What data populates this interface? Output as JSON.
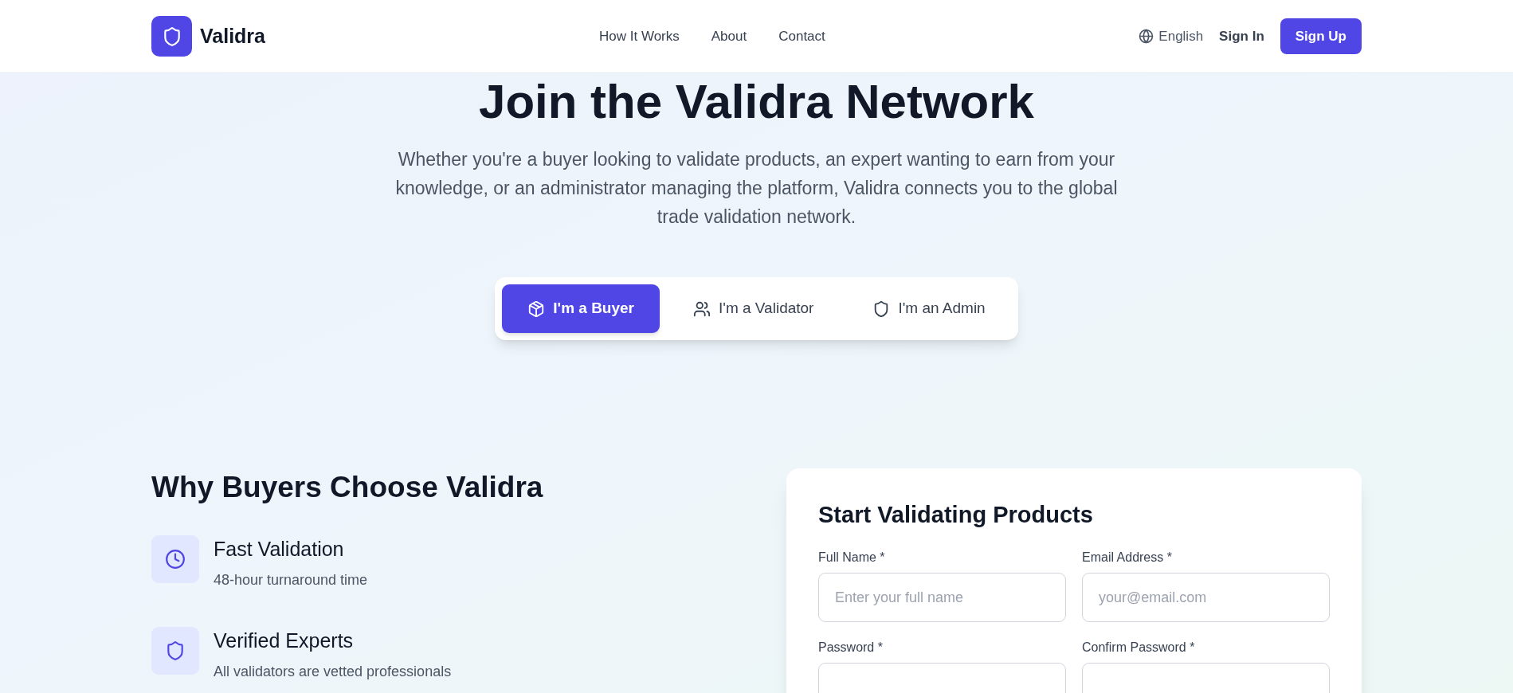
{
  "header": {
    "brand": "Validra",
    "nav": [
      "How It Works",
      "About",
      "Contact"
    ],
    "language": "English",
    "sign_in": "Sign In",
    "sign_up": "Sign Up"
  },
  "hero": {
    "title": "Join the Validra Network",
    "subtitle": "Whether you're a buyer looking to validate products, an expert wanting to earn from your knowledge, or an administrator managing the platform, Validra connects you to the global trade validation network."
  },
  "role_tabs": [
    {
      "label": "I'm a Buyer",
      "selected": true
    },
    {
      "label": "I'm a Validator",
      "selected": false
    },
    {
      "label": "I'm an Admin",
      "selected": false
    }
  ],
  "benefits": {
    "title": "Why Buyers Choose Validra",
    "items": [
      {
        "title": "Fast Validation",
        "description": "48-hour turnaround time"
      },
      {
        "title": "Verified Experts",
        "description": "All validators are vetted professionals"
      }
    ]
  },
  "form": {
    "title": "Start Validating Products",
    "fields": [
      {
        "label": "Full Name *",
        "placeholder": "Enter your full name"
      },
      {
        "label": "Email Address *",
        "placeholder": "your@email.com"
      },
      {
        "label": "Password *"
      },
      {
        "label": "Confirm Password *"
      }
    ]
  }
}
